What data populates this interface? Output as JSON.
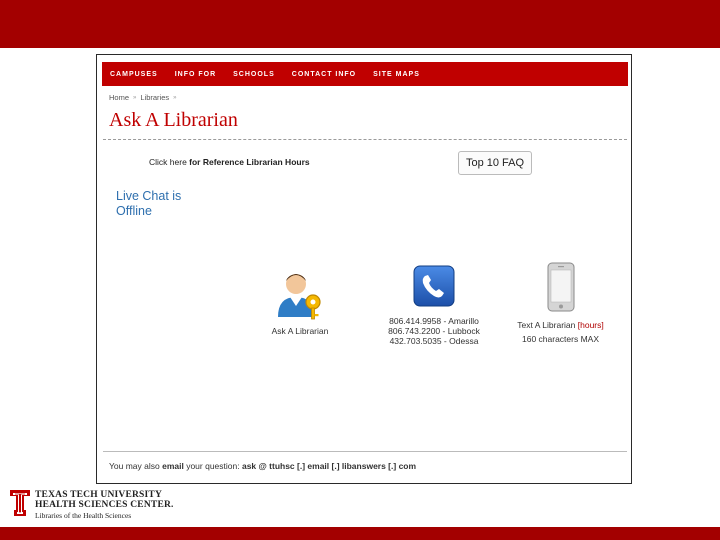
{
  "nav": {
    "items": [
      "CAMPUSES",
      "INFO FOR",
      "SCHOOLS",
      "CONTACT INFO",
      "SITE MAPS"
    ]
  },
  "breadcrumb": {
    "items": [
      "Home",
      "Libraries"
    ],
    "separator": "»"
  },
  "page": {
    "title": "Ask A Librarian"
  },
  "hours": {
    "prefix": "Click ",
    "link": "here",
    "suffix": " for Reference Librarian Hours"
  },
  "faq_button": {
    "label": "Top 10 FAQ"
  },
  "chat": {
    "status": "Live Chat is Offline"
  },
  "options": {
    "ask": {
      "label": "Ask A Librarian",
      "icon": "librarian-key-icon"
    },
    "phone": {
      "icon": "phone-icon",
      "lines": [
        "806.414.9958 - Amarillo",
        "806.743.2200 - Lubbock",
        "432.703.5035 - Odessa"
      ]
    },
    "text": {
      "icon": "mobile-phone-icon",
      "label": "Text A Librarian",
      "hours": "[hours]",
      "limit": "160 characters MAX"
    }
  },
  "footer": {
    "prefix": "You may also ",
    "email_word": "email",
    "middle": " your question: ",
    "address": "ask @ ttuhsc [.] email [.] libanswers [.] com"
  },
  "logo": {
    "line1": "TEXAS TECH UNIVERSITY",
    "line2": "HEALTH SCIENCES CENTER.",
    "line3": "Libraries of the Health Sciences"
  },
  "colors": {
    "brand_red": "#a30000",
    "nav_red": "#c00000",
    "link_blue": "#2e6fae"
  }
}
